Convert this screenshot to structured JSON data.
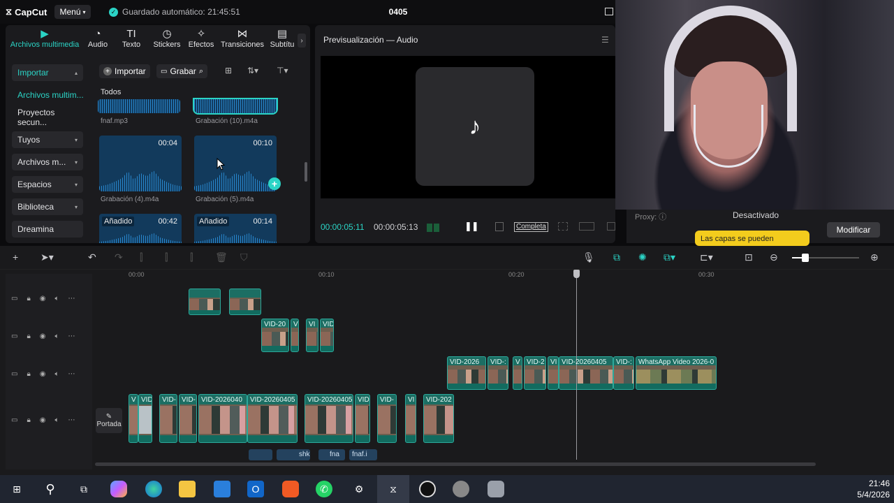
{
  "titlebar": {
    "app_name": "CapCut",
    "menu_label": "Menú",
    "autosave_text": "Guardado automático: 21:45:51",
    "project_name": "0405"
  },
  "media_tabs": [
    {
      "label": "Archivos multimedia",
      "icon": "media-icon"
    },
    {
      "label": "Audio",
      "icon": "audio-icon"
    },
    {
      "label": "Texto",
      "icon": "text-icon"
    },
    {
      "label": "Stickers",
      "icon": "sticker-icon"
    },
    {
      "label": "Efectos",
      "icon": "effects-icon"
    },
    {
      "label": "Transiciones",
      "icon": "transitions-icon"
    },
    {
      "label": "Subtítu",
      "icon": "subtitles-icon"
    }
  ],
  "sidebar": {
    "items": [
      {
        "label": "Importar"
      },
      {
        "label": "Archivos multim..."
      },
      {
        "label": "Proyectos secun..."
      },
      {
        "label": "Tuyos"
      },
      {
        "label": "Archivos m..."
      },
      {
        "label": "Espacios"
      },
      {
        "label": "Biblioteca"
      },
      {
        "label": "Dreamina"
      }
    ]
  },
  "media_toolbar": {
    "import_label": "Importar",
    "record_label": "Grabar"
  },
  "media": {
    "all_label": "Todos",
    "files": [
      {
        "name": "fnaf.mp3",
        "duration": ""
      },
      {
        "name": "Grabación (10).m4a",
        "duration": ""
      },
      {
        "name": "Grabación (4).m4a",
        "duration": "00:04"
      },
      {
        "name": "Grabación (5).m4a",
        "duration": "00:10"
      },
      {
        "name": "",
        "duration": "00:42",
        "badge": "Añadido"
      },
      {
        "name": "",
        "duration": "00:14",
        "badge": "Añadido"
      }
    ]
  },
  "preview": {
    "title": "Previsualización — Audio",
    "timecode_current": "00:00:05:11",
    "timecode_total": "00:00:05:13",
    "complete_label": "Completa"
  },
  "properties": {
    "proxy_label": "Proxy:",
    "proxy_value": "Desactivado",
    "tooltip_text": "Las capas se pueden",
    "modify_label": "Modificar"
  },
  "timeline": {
    "ruler_ticks": [
      "00:00",
      "00:10",
      "00:20",
      "00:30"
    ],
    "cover_label": "Portada",
    "clips_row2": [
      "VID-20",
      "V",
      "VI",
      "VID"
    ],
    "clips_row3": [
      "VID-2026",
      "VID-:",
      "V",
      "VID-2",
      "VI",
      "VID-20260405",
      "VID-:",
      "WhatsApp Video 2026-0"
    ],
    "clips_main": [
      "V",
      "VID",
      "VID-",
      "VID-:",
      "VID-2026040",
      "VID-20260405",
      "VID-20260405",
      "VID",
      "VID-",
      "VI",
      "VID-202"
    ],
    "audio_clips": [
      "shk",
      "fna",
      "fnaf.i"
    ]
  },
  "taskbar": {
    "time": "21:46",
    "date": "5/4/2026"
  },
  "colors": {
    "accent": "#2bd4c6",
    "panel": "#1b1b1e",
    "background": "#0b0b0d",
    "tooltip": "#f3cc1d"
  }
}
